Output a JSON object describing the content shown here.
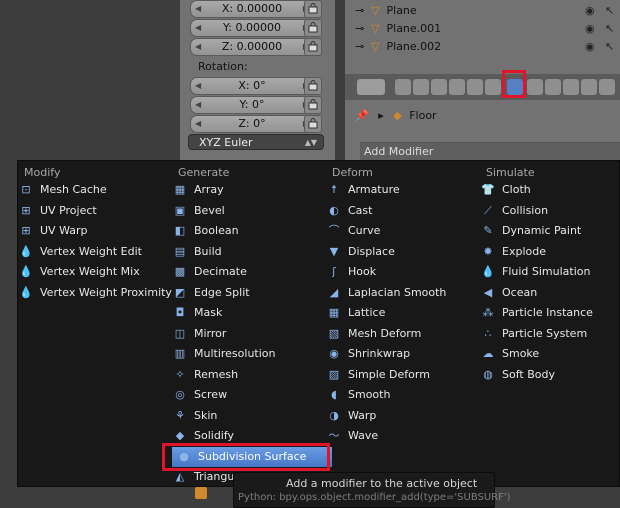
{
  "transform_panel": {
    "location": [
      {
        "label": "X: 0.00000"
      },
      {
        "label": "Y: 0.00000"
      },
      {
        "label": "Z: 0.00000"
      }
    ],
    "rotation_label": "Rotation:",
    "rotation": [
      {
        "label": "X: 0°"
      },
      {
        "label": "Y: 0°"
      },
      {
        "label": "Z: 0°"
      }
    ],
    "rotation_mode": "XYZ Euler"
  },
  "outliner": {
    "items": [
      {
        "name": "Plane"
      },
      {
        "name": "Plane.001"
      },
      {
        "name": "Plane.002"
      }
    ]
  },
  "properties": {
    "object_name": "Floor",
    "add_modifier_label": "Add Modifier"
  },
  "menu": {
    "columns": [
      {
        "title": "Modify",
        "items": [
          {
            "label": "Mesh Cache",
            "icon": "mesh-cache-icon",
            "glyph": "⊡"
          },
          {
            "label": "UV Project",
            "icon": "uv-project-icon",
            "glyph": "⊞"
          },
          {
            "label": "UV Warp",
            "icon": "uv-warp-icon",
            "glyph": "⊞"
          },
          {
            "label": "Vertex Weight Edit",
            "icon": "vertex-weight-icon",
            "glyph": "💧"
          },
          {
            "label": "Vertex Weight Mix",
            "icon": "vertex-weight-icon",
            "glyph": "💧"
          },
          {
            "label": "Vertex Weight Proximity",
            "icon": "vertex-weight-icon",
            "glyph": "💧"
          }
        ]
      },
      {
        "title": "Generate",
        "items": [
          {
            "label": "Array",
            "icon": "array-icon",
            "glyph": "▦"
          },
          {
            "label": "Bevel",
            "icon": "bevel-icon",
            "glyph": "▣"
          },
          {
            "label": "Boolean",
            "icon": "boolean-icon",
            "glyph": "◧"
          },
          {
            "label": "Build",
            "icon": "build-icon",
            "glyph": "▤"
          },
          {
            "label": "Decimate",
            "icon": "decimate-icon",
            "glyph": "▩"
          },
          {
            "label": "Edge Split",
            "icon": "edge-split-icon",
            "glyph": "◩"
          },
          {
            "label": "Mask",
            "icon": "mask-icon",
            "glyph": "◘"
          },
          {
            "label": "Mirror",
            "icon": "mirror-icon",
            "glyph": "◫"
          },
          {
            "label": "Multiresolution",
            "icon": "multires-icon",
            "glyph": "▥"
          },
          {
            "label": "Remesh",
            "icon": "remesh-icon",
            "glyph": "✧"
          },
          {
            "label": "Screw",
            "icon": "screw-icon",
            "glyph": "◎"
          },
          {
            "label": "Skin",
            "icon": "skin-icon",
            "glyph": "⚘"
          },
          {
            "label": "Solidify",
            "icon": "solidify-icon",
            "glyph": "◆"
          },
          {
            "label": "Subdivision Surface",
            "icon": "subsurf-icon",
            "glyph": "●"
          },
          {
            "label": "Triangulate",
            "icon": "triangulate-icon",
            "glyph": "◭"
          }
        ]
      },
      {
        "title": "Deform",
        "items": [
          {
            "label": "Armature",
            "icon": "armature-icon",
            "glyph": "☨"
          },
          {
            "label": "Cast",
            "icon": "cast-icon",
            "glyph": "◐"
          },
          {
            "label": "Curve",
            "icon": "curve-icon",
            "glyph": "⌒"
          },
          {
            "label": "Displace",
            "icon": "displace-icon",
            "glyph": "▼"
          },
          {
            "label": "Hook",
            "icon": "hook-icon",
            "glyph": "ʃ"
          },
          {
            "label": "Laplacian Smooth",
            "icon": "laplacian-smooth-icon",
            "glyph": "◢"
          },
          {
            "label": "Lattice",
            "icon": "lattice-icon",
            "glyph": "▦"
          },
          {
            "label": "Mesh Deform",
            "icon": "mesh-deform-icon",
            "glyph": "▧"
          },
          {
            "label": "Shrinkwrap",
            "icon": "shrinkwrap-icon",
            "glyph": "◉"
          },
          {
            "label": "Simple Deform",
            "icon": "simple-deform-icon",
            "glyph": "▨"
          },
          {
            "label": "Smooth",
            "icon": "smooth-icon",
            "glyph": "◖"
          },
          {
            "label": "Warp",
            "icon": "warp-icon",
            "glyph": "◑"
          },
          {
            "label": "Wave",
            "icon": "wave-icon",
            "glyph": "〜"
          }
        ]
      },
      {
        "title": "Simulate",
        "items": [
          {
            "label": "Cloth",
            "icon": "cloth-icon",
            "glyph": "👕"
          },
          {
            "label": "Collision",
            "icon": "collision-icon",
            "glyph": "⟋"
          },
          {
            "label": "Dynamic Paint",
            "icon": "dynamic-paint-icon",
            "glyph": "✎"
          },
          {
            "label": "Explode",
            "icon": "explode-icon",
            "glyph": "✸"
          },
          {
            "label": "Fluid Simulation",
            "icon": "fluid-icon",
            "glyph": "💧"
          },
          {
            "label": "Ocean",
            "icon": "ocean-icon",
            "glyph": "◀"
          },
          {
            "label": "Particle Instance",
            "icon": "particle-instance-icon",
            "glyph": "⁂"
          },
          {
            "label": "Particle System",
            "icon": "particle-system-icon",
            "glyph": "∴"
          },
          {
            "label": "Smoke",
            "icon": "smoke-icon",
            "glyph": "☁"
          },
          {
            "label": "Soft Body",
            "icon": "soft-body-icon",
            "glyph": "◍"
          }
        ]
      }
    ],
    "highlighted_item": "Subdivision Surface"
  },
  "tooltip": {
    "description": "Add a modifier to the active object",
    "python": "Python: bpy.ops.object.modifier_add(type='SUBSURF')"
  },
  "colors": {
    "highlight": "#5680c2",
    "annotation_red": "#e0142a",
    "menu_bg": "#181818"
  }
}
